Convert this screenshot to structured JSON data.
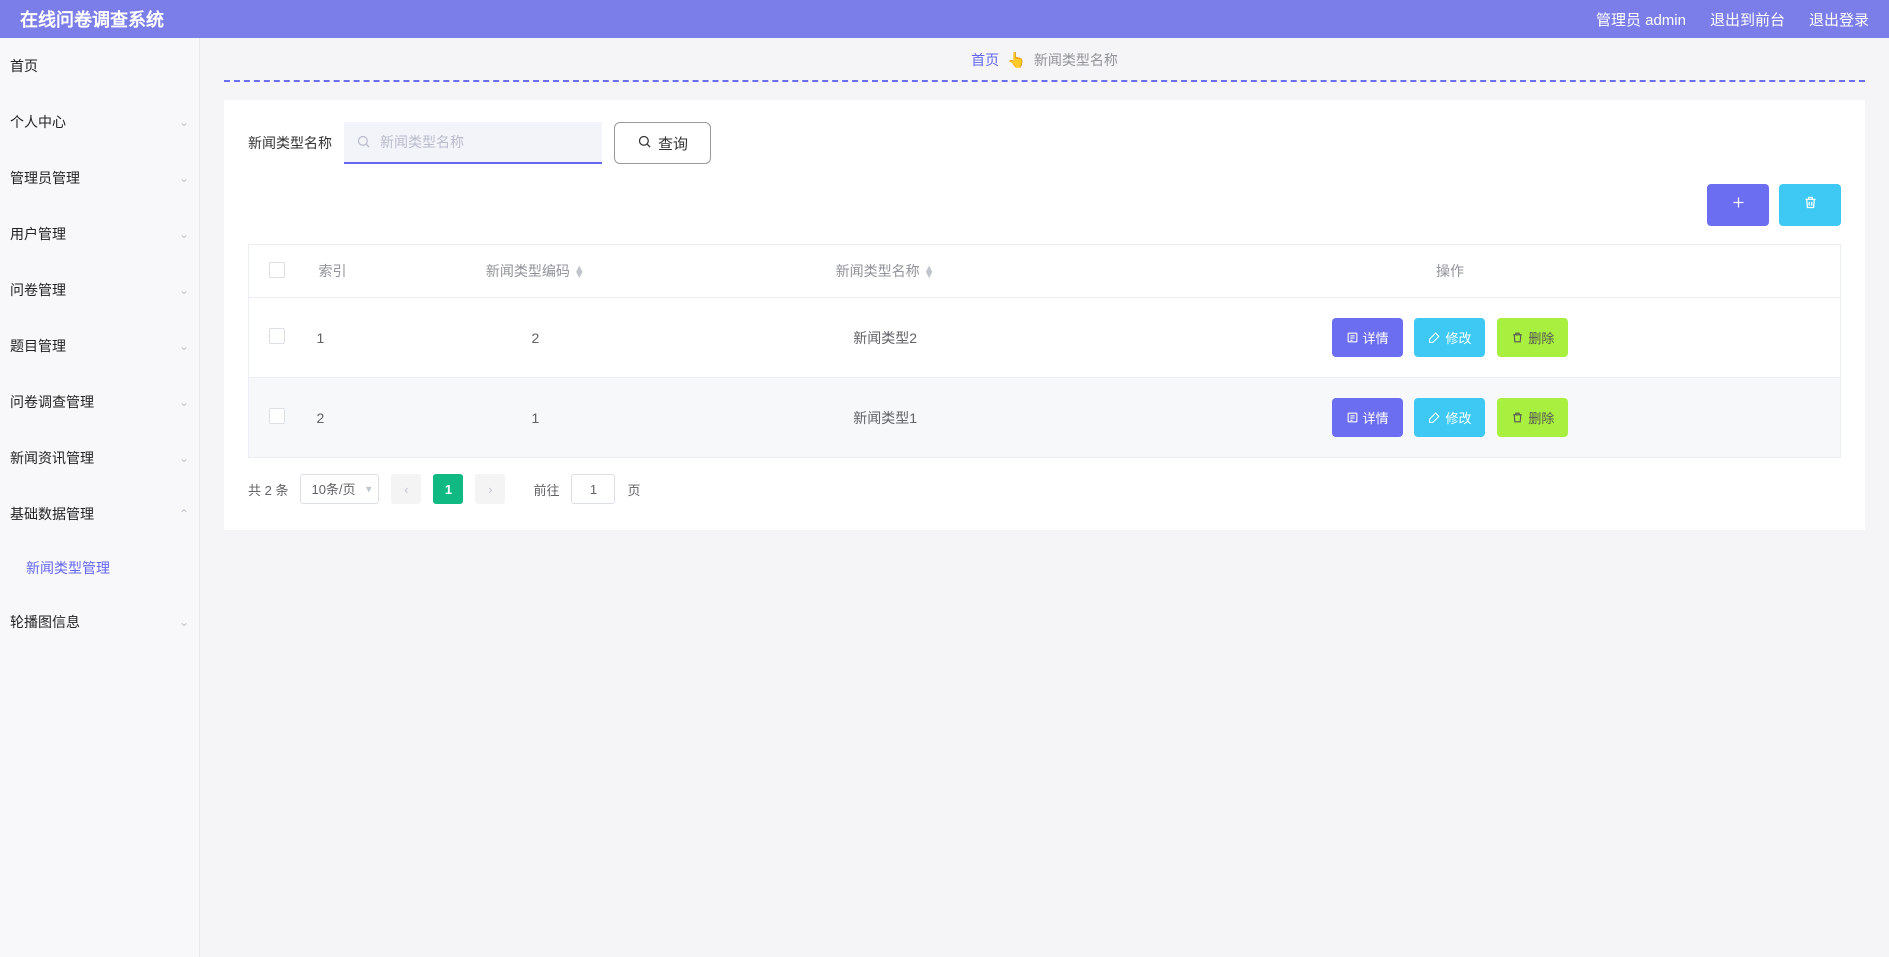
{
  "header": {
    "title": "在线问卷调查系统",
    "admin_label": "管理员 admin",
    "to_front": "退出到前台",
    "logout": "退出登录"
  },
  "sidebar": {
    "home": "首页",
    "items": [
      {
        "label": "个人中心"
      },
      {
        "label": "管理员管理"
      },
      {
        "label": "用户管理"
      },
      {
        "label": "问卷管理"
      },
      {
        "label": "题目管理"
      },
      {
        "label": "问卷调查管理"
      },
      {
        "label": "新闻资讯管理"
      },
      {
        "label": "基础数据管理",
        "expanded": true,
        "children": [
          {
            "label": "新闻类型管理"
          }
        ]
      },
      {
        "label": "轮播图信息"
      }
    ]
  },
  "breadcrumb": {
    "home": "首页",
    "icon": "👆",
    "current": "新闻类型名称"
  },
  "search": {
    "label": "新闻类型名称",
    "placeholder": "新闻类型名称",
    "query_btn": "查询"
  },
  "toolbar": {
    "add_icon": "plus",
    "del_icon": "trash"
  },
  "table": {
    "headers": {
      "index": "索引",
      "code": "新闻类型编码",
      "name": "新闻类型名称",
      "action": "操作"
    },
    "rows": [
      {
        "index": "1",
        "code": "2",
        "name": "新闻类型2"
      },
      {
        "index": "2",
        "code": "1",
        "name": "新闻类型1"
      }
    ],
    "actions": {
      "detail": "详情",
      "edit": "修改",
      "delete": "删除"
    }
  },
  "pagination": {
    "total": "共 2 条",
    "per_page": "10条/页",
    "current_page": "1",
    "goto_prefix": "前往",
    "goto_value": "1",
    "goto_suffix": "页"
  }
}
